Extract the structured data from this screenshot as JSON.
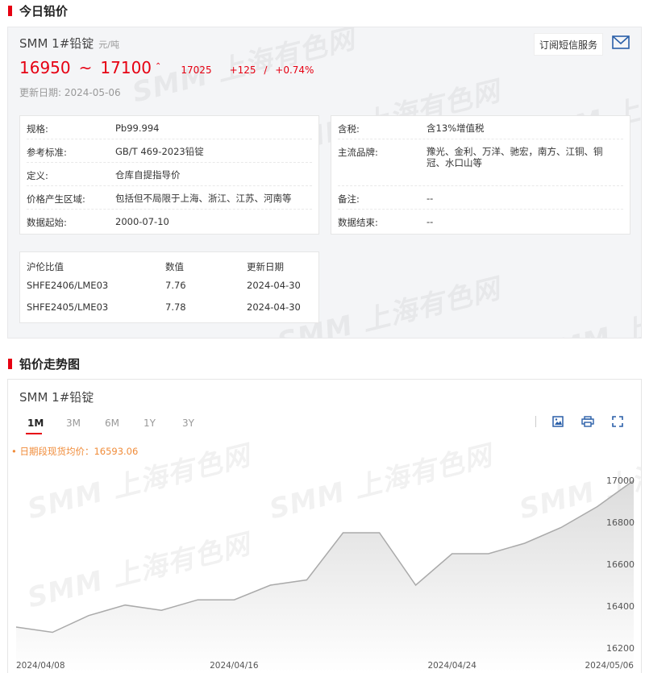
{
  "section1": {
    "title": "今日铅价"
  },
  "watermark": "SMM 上海有色网",
  "price": {
    "product": "SMM 1#铅锭",
    "unit": "元/吨",
    "low": "16950",
    "tilde": "~",
    "high": "17100",
    "arrow": "⌃",
    "avg": "17025",
    "change": "+125",
    "slash": "/",
    "change_pct": "+0.74%",
    "update_date": "更新日期: 2024-05-06",
    "subscribe_label": "订阅短信服务",
    "mail_icon": "mail-icon"
  },
  "specs_left": [
    {
      "key": "规格:",
      "value": "Pb99.994"
    },
    {
      "key": "参考标准:",
      "value": "GB/T 469-2023铅锭"
    },
    {
      "key": "定义:",
      "value": "仓库自提指导价"
    },
    {
      "key": "价格产生区域:",
      "value": "包括但不局限于上海、浙江、江苏、河南等"
    },
    {
      "key": "数据起始:",
      "value": "2000-07-10"
    }
  ],
  "specs_right": [
    {
      "key": "含税:",
      "value": "含13%增值税"
    },
    {
      "key": "主流品牌:",
      "value": "豫光、金利、万洋、驰宏，南方、江铜、铜冠、水口山等"
    },
    {
      "key": "备注:",
      "value": "--"
    },
    {
      "key": "数据结束:",
      "value": "--"
    }
  ],
  "ratio_table": {
    "headers": [
      "沪伦比值",
      "数值",
      "更新日期"
    ],
    "rows": [
      [
        "SHFE2406/LME03",
        "7.76",
        "2024-04-30"
      ],
      [
        "SHFE2405/LME03",
        "7.78",
        "2024-04-30"
      ]
    ]
  },
  "section2": {
    "title": "铅价走势图"
  },
  "chart_panel": {
    "title": "SMM 1#铅锭",
    "range_tabs": [
      "1M",
      "3M",
      "6M",
      "1Y",
      "3Y"
    ],
    "active_tab": "1M",
    "avg_note": "• 日期段现货均价：16593.06",
    "tool_icons": [
      "download-image-icon",
      "print-icon",
      "fullscreen-icon"
    ]
  },
  "chart_data": {
    "type": "area",
    "title": "",
    "x": [
      "2024/04/08",
      "2024/04/09",
      "2024/04/10",
      "2024/04/11",
      "2024/04/12",
      "2024/04/15",
      "2024/04/16",
      "2024/04/17",
      "2024/04/18",
      "2024/04/19",
      "2024/04/22",
      "2024/04/23",
      "2024/04/24",
      "2024/04/25",
      "2024/04/26",
      "2024/04/29",
      "2024/04/30",
      "2024/05/06"
    ],
    "series": [
      {
        "values": [
          16300,
          16275,
          16355,
          16405,
          16380,
          16430,
          16430,
          16500,
          16525,
          16750,
          16750,
          16500,
          16650,
          16650,
          16700,
          16775,
          16875,
          17000
        ]
      }
    ],
    "x_tick_labels": [
      "2024/04/08",
      "2024/04/16",
      "2024/04/24",
      "2024/05/06"
    ],
    "y_tick_labels": [
      "16200",
      "16400",
      "16600",
      "16800",
      "17000"
    ],
    "ylim": [
      16200,
      17000
    ],
    "y_axis_side": "right",
    "grid": false,
    "colors": {
      "line": "#aaaaaa",
      "fill_top": "#dcdcdc",
      "fill_bottom": "#ffffff"
    }
  },
  "colors": {
    "accent": "#e60012",
    "avg_note": "#f08c3a",
    "panel_bg": "#f4f5f7"
  }
}
